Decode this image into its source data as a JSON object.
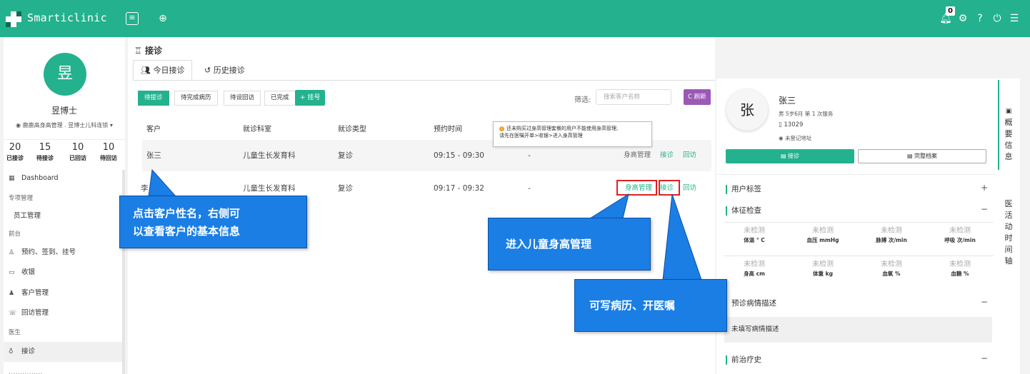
{
  "app": {
    "name": "Smarticlinic",
    "notification_count": "0"
  },
  "sidebar": {
    "avatar_char": "昱",
    "user_name": "昱博士",
    "org": "鹿鹿高身高管理 . 昱博士儿科连锁",
    "stats": [
      {
        "value": "20",
        "label": "已接诊"
      },
      {
        "value": "15",
        "label": "待接诊"
      },
      {
        "value": "10",
        "label": "已回访"
      },
      {
        "value": "10",
        "label": "待回访"
      }
    ],
    "nav": {
      "dashboard": "Dashboard",
      "group_special": "专项管理",
      "staff": "员工管理",
      "group_front": "前台",
      "appointment": "预约、签到、挂号",
      "cashier": "收银",
      "customer": "客户管理",
      "followup": "回访管理",
      "group_doctor": "医生",
      "reception": "接诊",
      "next_cut": "……………"
    }
  },
  "main": {
    "title": "接诊",
    "tabs": [
      "今日接诊",
      "历史接诊"
    ],
    "filters": [
      "待接诊",
      "待完成病历",
      "待设回访",
      "已完成"
    ],
    "add_label": "+ 挂号",
    "filter_label": "筛选:",
    "search_placeholder": "搜索客户名称",
    "refresh_label": "C 刷新",
    "columns": [
      "客户",
      "就诊科室",
      "就诊类型",
      "预约时间"
    ],
    "rows": [
      {
        "customer": "张三",
        "dept": "儿童生长发育科",
        "type": "复诊",
        "time": "09:15 - 09:30",
        "extra": "-",
        "actions": [
          "身高管理",
          "接诊",
          "回访"
        ]
      },
      {
        "customer": "李",
        "dept": "儿童生长发育科",
        "type": "复诊",
        "time": "09:17 - 09:32",
        "extra": "-",
        "actions": [
          "身高管理",
          "接诊",
          "回访"
        ]
      }
    ],
    "tooltip_line1": "还未购买过身高管理套餐的用户不能使用身高管理,",
    "tooltip_line2": "请先在医嘱开单>收银>进入身高管理"
  },
  "right": {
    "avatar_char": "张",
    "name": "张三",
    "meta": "男  5岁6月  第 1 次服务",
    "phone": "13029",
    "address": "未登记地址",
    "btn_reception": "接诊",
    "btn_archive": "完整档案",
    "sections": {
      "tags": "用户标签",
      "vitals": "体征检查",
      "pre_desc": "预诊病情描述",
      "prior": "前治疗史"
    },
    "vitals": [
      {
        "value": "未检测",
        "label": "体温 ° C"
      },
      {
        "value": "未检测",
        "label": "血压 mmHg"
      },
      {
        "value": "未检测",
        "label": "脉搏 次/min"
      },
      {
        "value": "未检测",
        "label": "呼吸 次/min"
      },
      {
        "value": "未检测",
        "label": "身高 cm"
      },
      {
        "value": "未检测",
        "label": "体重 kg"
      },
      {
        "value": "未检测",
        "label": "血氧 %"
      },
      {
        "value": "未检测",
        "label": "血糖 %"
      }
    ],
    "desc_note": "未填写病情描述"
  },
  "vtabs": {
    "overview": [
      "概",
      "要",
      "信",
      "息"
    ],
    "timeline": [
      "医",
      "活",
      "动",
      "时",
      "间",
      "轴"
    ]
  },
  "callouts": {
    "c1_line1": "点击客户性名，右侧可",
    "c1_line2": "以查看客户的基本信息",
    "c2": "进入儿童身高管理",
    "c3": "可写病历、开医嘱"
  },
  "colors": {
    "brand": "#23b28d",
    "callout": "#1b7ee5",
    "highlight": "#e02020",
    "refresh": "#9b59b6"
  }
}
